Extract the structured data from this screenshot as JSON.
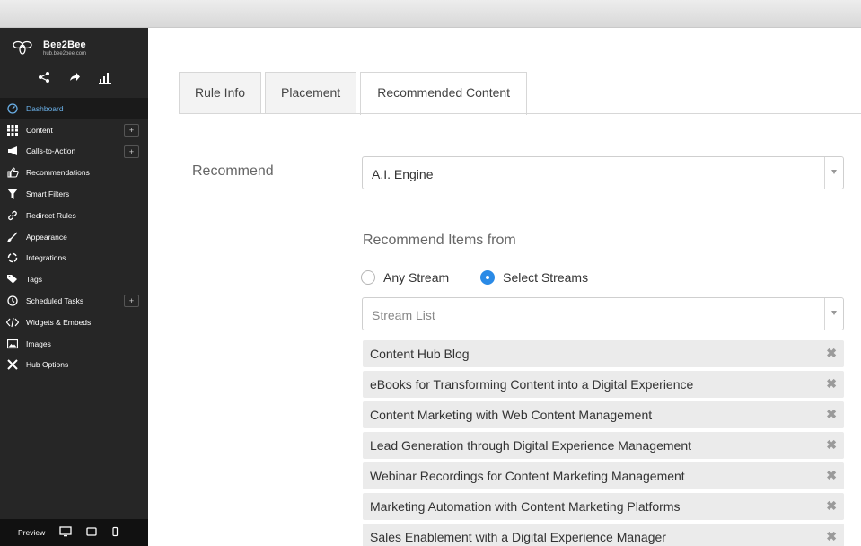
{
  "brand": {
    "name": "Bee2Bee",
    "url": "hub.bee2bee.com"
  },
  "quick_icons": [
    "share-icon",
    "forward-icon",
    "analytics-icon"
  ],
  "sidebar": {
    "items": [
      {
        "label": "Dashboard",
        "icon": "dashboard-icon",
        "active": true,
        "plus": false
      },
      {
        "label": "Content",
        "icon": "grid-icon",
        "active": false,
        "plus": true
      },
      {
        "label": "Calls-to-Action",
        "icon": "megaphone-icon",
        "active": false,
        "plus": true
      },
      {
        "label": "Recommendations",
        "icon": "thumbs-up-icon",
        "active": false,
        "plus": false
      },
      {
        "label": "Smart Filters",
        "icon": "filter-icon",
        "active": false,
        "plus": false
      },
      {
        "label": "Redirect Rules",
        "icon": "link-icon",
        "active": false,
        "plus": false
      },
      {
        "label": "Appearance",
        "icon": "brush-icon",
        "active": false,
        "plus": false
      },
      {
        "label": "Integrations",
        "icon": "integrations-icon",
        "active": false,
        "plus": false
      },
      {
        "label": "Tags",
        "icon": "tags-icon",
        "active": false,
        "plus": false
      },
      {
        "label": "Scheduled Tasks",
        "icon": "clock-icon",
        "active": false,
        "plus": true
      },
      {
        "label": "Widgets & Embeds",
        "icon": "code-icon",
        "active": false,
        "plus": false
      },
      {
        "label": "Images",
        "icon": "image-icon",
        "active": false,
        "plus": false
      },
      {
        "label": "Hub Options",
        "icon": "tools-icon",
        "active": false,
        "plus": false
      }
    ],
    "plus_label": "+",
    "footer": {
      "preview_label": "Preview",
      "devices": [
        "desktop-icon",
        "tablet-icon",
        "mobile-icon"
      ]
    }
  },
  "tabs": [
    {
      "label": "Rule Info",
      "active": false
    },
    {
      "label": "Placement",
      "active": false
    },
    {
      "label": "Recommended Content",
      "active": true
    }
  ],
  "form": {
    "recommend_label": "Recommend",
    "engine_value": "A.I. Engine",
    "items_from_label": "Recommend Items from",
    "radio_any": "Any Stream",
    "radio_select": "Select Streams",
    "selected_radio": "select",
    "stream_placeholder": "Stream List"
  },
  "streams": [
    "Content Hub Blog",
    "eBooks for Transforming Content into a Digital Experience",
    "Content Marketing with Web Content Management",
    "Lead Generation through Digital Experience Management",
    "Webinar Recordings for Content Marketing Management",
    "Marketing Automation with Content Marketing Platforms",
    "Sales Enablement with a Digital Experience Manager"
  ],
  "colors": {
    "sidebar_bg": "#262626",
    "active_text": "#6ab0e8",
    "radio_on": "#2a8ae6",
    "chip_bg": "#ebebeb"
  }
}
